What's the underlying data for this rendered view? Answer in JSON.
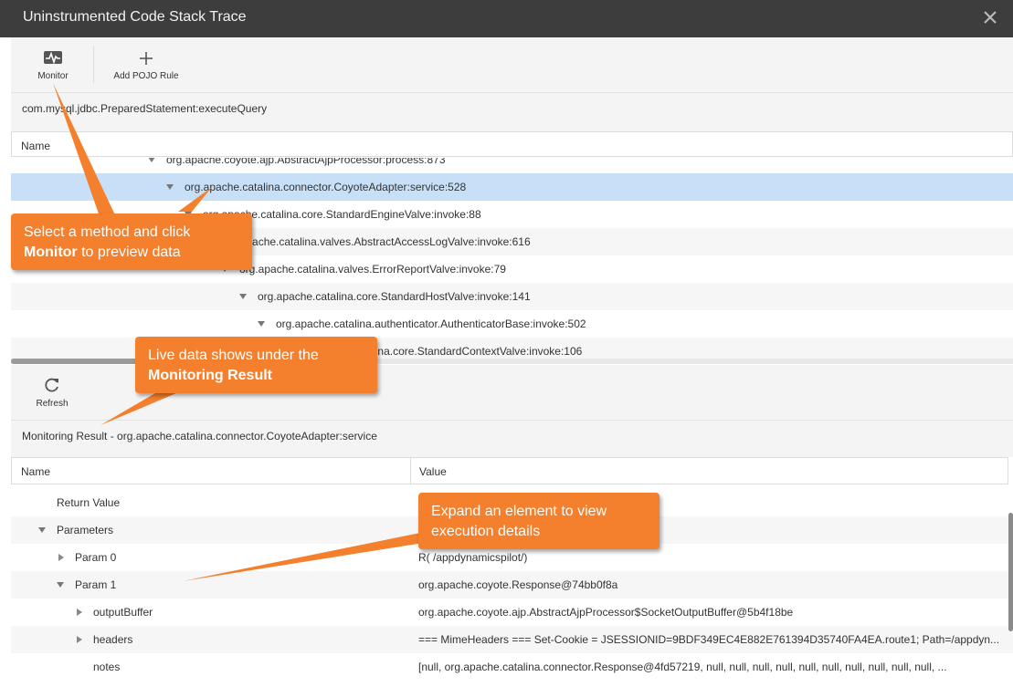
{
  "window": {
    "title": "Uninstrumented Code Stack Trace",
    "close_icon": "close-icon"
  },
  "top_toolbar": {
    "monitor_label": "Monitor",
    "monitor_icon": "pulse-icon",
    "add_pojo_label": "Add POJO Rule",
    "add_pojo_icon": "plus-icon"
  },
  "method_path": "com.mysql.jdbc.PreparedStatement:executeQuery",
  "tree": {
    "header_name": "Name",
    "rows": [
      {
        "label": "org.apache.coyote.ajp.AbstractAjpProcessor:process:873"
      },
      {
        "label": "org.apache.catalina.connector.CoyoteAdapter:service:528",
        "selected": true
      },
      {
        "label": "org.apache.catalina.core.StandardEngineValve:invoke:88"
      },
      {
        "label": "org.apache.catalina.valves.AbstractAccessLogValve:invoke:616"
      },
      {
        "label": "org.apache.catalina.valves.ErrorReportValve:invoke:79"
      },
      {
        "label": "org.apache.catalina.core.StandardHostValve:invoke:141"
      },
      {
        "label": "org.apache.catalina.authenticator.AuthenticatorBase:invoke:502"
      },
      {
        "label": "org.apache.catalina.core.StandardContextValve:invoke:106"
      }
    ]
  },
  "bottom_toolbar": {
    "refresh_label": "Refresh",
    "refresh_icon": "refresh-icon"
  },
  "monitoring_result": {
    "title": "Monitoring Result - org.apache.catalina.connector.CoyoteAdapter:service",
    "col_name": "Name",
    "col_value": "Value",
    "rows": [
      {
        "name": "Return Value",
        "value": ""
      },
      {
        "name": "Parameters",
        "value": ""
      },
      {
        "name": "Param 0",
        "value": "R( /appdynamicspilot/)"
      },
      {
        "name": "Param 1",
        "value": "org.apache.coyote.Response@74bb0f8a"
      },
      {
        "name": "outputBuffer",
        "value": "org.apache.coyote.ajp.AbstractAjpProcessor$SocketOutputBuffer@5b4f18be"
      },
      {
        "name": "headers",
        "value": "=== MimeHeaders === Set-Cookie = JSESSIONID=9BDF349EC4E882E761394D35740FA4EA.route1; Path=/appdyn..."
      },
      {
        "name": "notes",
        "value": "[null, org.apache.catalina.connector.Response@4fd57219, null, null, null, null, null, null, null, null, null, null, ..."
      }
    ]
  },
  "callouts": {
    "monitor_line1": "Select a method and click",
    "monitor_bold": "Monitor",
    "monitor_rest": " to preview data",
    "live_line1": "Live data shows under the",
    "live_bold": "Monitoring Result",
    "expand_text": "Expand an element to view execution details"
  },
  "colors": {
    "titlebar": "#3d3d3d",
    "selected_row": "#c7e0f8",
    "callout": "#f47f2c"
  }
}
